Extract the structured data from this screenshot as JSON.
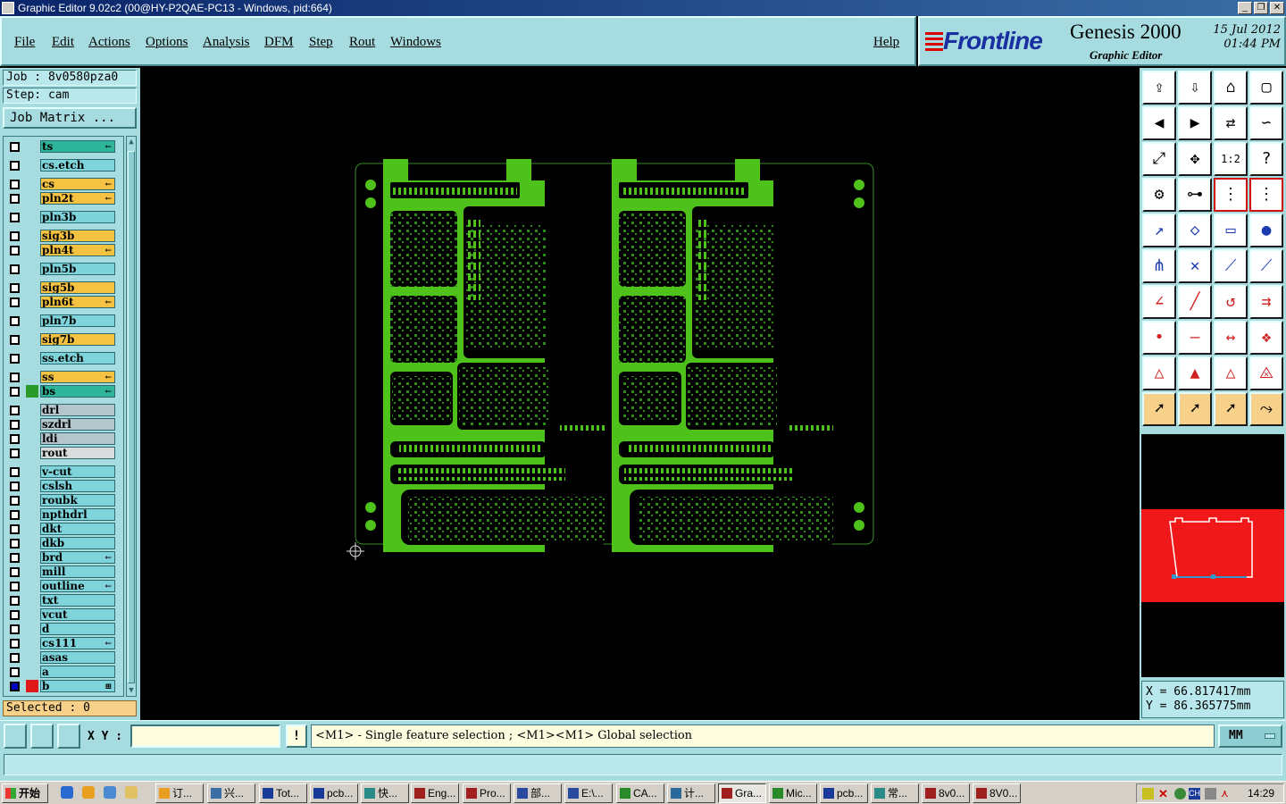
{
  "window": {
    "title": "Graphic Editor 9.02c2 (00@HY-P2QAE-PC13 - Windows, pid:664)"
  },
  "menu": {
    "items": [
      "File",
      "Edit",
      "Actions",
      "Options",
      "Analysis",
      "DFM",
      "Step",
      "Rout",
      "Windows"
    ],
    "help": "Help"
  },
  "brand": {
    "logo": "Frontline",
    "product": "Genesis 2000",
    "subtitle": "Graphic Editor",
    "date": "15 Jul 2012",
    "time": "01:44 PM"
  },
  "left": {
    "job": "Job : 8v0580pza0",
    "step": "Step: cam",
    "job_matrix": "Job Matrix ...",
    "selected": "Selected : 0",
    "layers": [
      {
        "name": "ts",
        "color": "#2eb59a",
        "mark": "←"
      },
      {
        "name": "cs.etch",
        "color": "#7fd3da",
        "mark": ""
      },
      {
        "name": "cs",
        "color": "#f5c242",
        "mark": "←"
      },
      {
        "name": "pln2t",
        "color": "#f5c242",
        "mark": "←"
      },
      {
        "name": "pln3b",
        "color": "#7fd3da",
        "mark": ""
      },
      {
        "name": "sig3b",
        "color": "#f5c242",
        "mark": ""
      },
      {
        "name": "pln4t",
        "color": "#f5c242",
        "mark": "←"
      },
      {
        "name": "pln5b",
        "color": "#7fd3da",
        "mark": ""
      },
      {
        "name": "sig5b",
        "color": "#f5c242",
        "mark": ""
      },
      {
        "name": "pln6t",
        "color": "#f5c242",
        "mark": "←"
      },
      {
        "name": "pln7b",
        "color": "#7fd3da",
        "mark": ""
      },
      {
        "name": "sig7b",
        "color": "#f5c242",
        "mark": ""
      },
      {
        "name": "ss.etch",
        "color": "#7fd3da",
        "mark": ""
      },
      {
        "name": "ss",
        "color": "#f5c242",
        "mark": "←"
      },
      {
        "name": "bs",
        "color": "#2eb59a",
        "mark": "←",
        "swatch": "#2a9a2a"
      },
      {
        "name": "drl",
        "color": "#b4c6cc",
        "mark": ""
      },
      {
        "name": "szdrl",
        "color": "#b4c6cc",
        "mark": ""
      },
      {
        "name": "ldi",
        "color": "#b4c6cc",
        "mark": ""
      },
      {
        "name": "rout",
        "color": "#d8dcdc",
        "mark": ""
      },
      {
        "name": "v-cut",
        "color": "#7fd3da",
        "mark": ""
      },
      {
        "name": "cslsh",
        "color": "#7fd3da",
        "mark": ""
      },
      {
        "name": "roubk",
        "color": "#7fd3da",
        "mark": ""
      },
      {
        "name": "npthdrl",
        "color": "#7fd3da",
        "mark": ""
      },
      {
        "name": "dkt",
        "color": "#7fd3da",
        "mark": ""
      },
      {
        "name": "dkb",
        "color": "#7fd3da",
        "mark": ""
      },
      {
        "name": "brd",
        "color": "#7fd3da",
        "mark": "←"
      },
      {
        "name": "mill",
        "color": "#7fd3da",
        "mark": ""
      },
      {
        "name": "outline",
        "color": "#7fd3da",
        "mark": "←"
      },
      {
        "name": "txt",
        "color": "#7fd3da",
        "mark": ""
      },
      {
        "name": "vcut",
        "color": "#7fd3da",
        "mark": ""
      },
      {
        "name": "d",
        "color": "#7fd3da",
        "mark": ""
      },
      {
        "name": "cs111",
        "color": "#7fd3da",
        "mark": "←"
      },
      {
        "name": "asas",
        "color": "#7fd3da",
        "mark": ""
      },
      {
        "name": "a",
        "color": "#7fd3da",
        "mark": ""
      },
      {
        "name": "b",
        "color": "#7fd3da",
        "mark": "⊞",
        "swatch": "#e01818",
        "checked": true
      }
    ]
  },
  "coords": {
    "x": "X = 66.817417mm",
    "y": "Y = 86.365775mm"
  },
  "bottom": {
    "xy_label": "X Y :",
    "xy_value": "",
    "excl": "!",
    "prompt": "<M1> - Single feature selection ; <M1><M1> Global selection",
    "units": "MM"
  },
  "taskbar": {
    "start": "开始",
    "tasks": [
      "订...",
      "兴...",
      "Tot...",
      "pcb...",
      "快...",
      "Eng...",
      "Pro...",
      "部...",
      "E:\\...",
      "CA...",
      "计...",
      "Gra...",
      "Mic...",
      "pcb...",
      "常...",
      "8v0...",
      "8V0..."
    ],
    "active_index": 11,
    "clock": "14:29"
  }
}
